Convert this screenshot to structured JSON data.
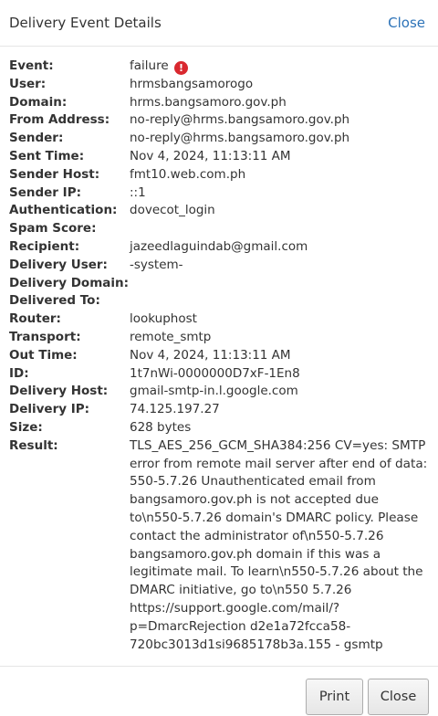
{
  "dialog": {
    "title": "Delivery Event Details",
    "close_link": "Close"
  },
  "details": [
    {
      "label": "Event:",
      "value": "failure",
      "icon": "alert-icon",
      "icon_glyph": "!"
    },
    {
      "label": "User:",
      "value": "hrmsbangsamorogo"
    },
    {
      "label": "Domain:",
      "value": "hrms.bangsamoro.gov.ph"
    },
    {
      "label": "From Address:",
      "value": "no-reply@hrms.bangsamoro.gov.ph"
    },
    {
      "label": "Sender:",
      "value": "no-reply@hrms.bangsamoro.gov.ph"
    },
    {
      "label": "Sent Time:",
      "value": "Nov 4, 2024, 11:13:11 AM"
    },
    {
      "label": "Sender Host:",
      "value": "fmt10.web.com.ph"
    },
    {
      "label": "Sender IP:",
      "value": "::1"
    },
    {
      "label": "Authentication:",
      "value": "dovecot_login"
    },
    {
      "label": "Spam Score:",
      "value": ""
    },
    {
      "label": "Recipient:",
      "value": "jazeedlaguindab@gmail.com"
    },
    {
      "label": "Delivery User:",
      "value": "-system-"
    },
    {
      "label": "Delivery Domain:",
      "value": ""
    },
    {
      "label": "Delivered To:",
      "value": ""
    },
    {
      "label": "Router:",
      "value": "lookuphost"
    },
    {
      "label": "Transport:",
      "value": "remote_smtp"
    },
    {
      "label": "Out Time:",
      "value": "Nov 4, 2024, 11:13:11 AM"
    },
    {
      "label": "ID:",
      "value": "1t7nWi-0000000D7xF-1En8"
    },
    {
      "label": "Delivery Host:",
      "value": "gmail-smtp-in.l.google.com"
    },
    {
      "label": "Delivery IP:",
      "value": "74.125.197.27"
    },
    {
      "label": "Size:",
      "value": "628 bytes"
    },
    {
      "label": "Result:",
      "value": "TLS_AES_256_GCM_SHA384:256 CV=yes: SMTP error from remote mail server after end of data: 550-5.7.26 Unauthenticated email from bangsamoro.gov.ph is not accepted due to\\n550-5.7.26 domain's DMARC policy. Please contact the administrator of\\n550-5.7.26 bangsamoro.gov.ph domain if this was a legitimate mail. To learn\\n550-5.7.26 about the DMARC initiative, go to\\n550 5.7.26 https://support.google.com/mail/?p=DmarcRejection d2e1a72fcca58-720bc3013d1si9685178b3a.155 - gsmtp"
    }
  ],
  "footer": {
    "print_label": "Print",
    "close_label": "Close"
  }
}
